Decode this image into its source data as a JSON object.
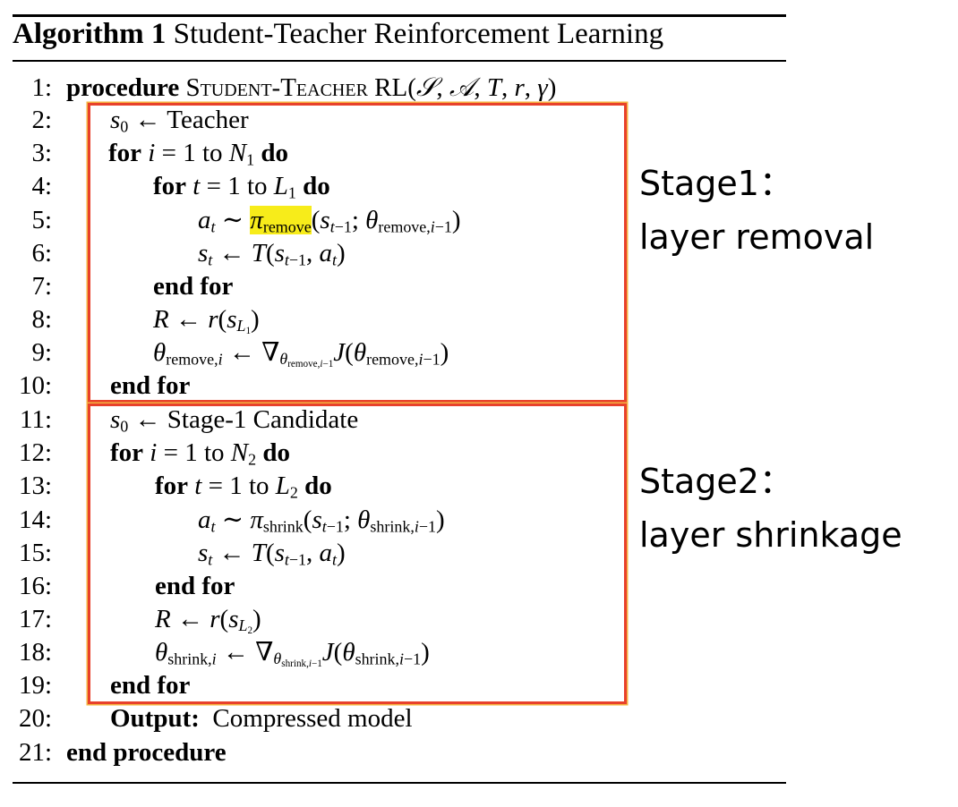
{
  "algorithm": {
    "title_bold": "Algorithm 1",
    "title_rest": "Student-Teacher Reinforcement Learning"
  },
  "lines": [
    {
      "n": "1:"
    },
    {
      "n": "2:"
    },
    {
      "n": "3:"
    },
    {
      "n": "4:"
    },
    {
      "n": "5:"
    },
    {
      "n": "6:"
    },
    {
      "n": "7:"
    },
    {
      "n": "8:"
    },
    {
      "n": "9:"
    },
    {
      "n": "10:"
    },
    {
      "n": "11:"
    },
    {
      "n": "12:"
    },
    {
      "n": "13:"
    },
    {
      "n": "14:"
    },
    {
      "n": "15:"
    },
    {
      "n": "16:"
    },
    {
      "n": "17:"
    },
    {
      "n": "18:"
    },
    {
      "n": "19:"
    },
    {
      "n": "20:"
    },
    {
      "n": "21:"
    }
  ],
  "text": {
    "procedure": "procedure",
    "proc_name": "Student-Teacher RL",
    "teacher": "Teacher",
    "stage1_candidate": "Stage-1 Candidate",
    "for": "for",
    "do": "do",
    "to": "to",
    "end_for": "end for",
    "output_label": "Output:",
    "output_value": "Compressed model",
    "end_procedure": "end procedure",
    "remove": "remove",
    "shrink": "shrink"
  },
  "annotations": {
    "stage1_title": "Stage1：",
    "stage1_desc": "layer removal",
    "stage2_title": "Stage2：",
    "stage2_desc": "layer shrinkage"
  },
  "colors": {
    "box_border": "#e8412b",
    "box_glow": "#f4b340",
    "highlight": "#f7ec1a"
  }
}
